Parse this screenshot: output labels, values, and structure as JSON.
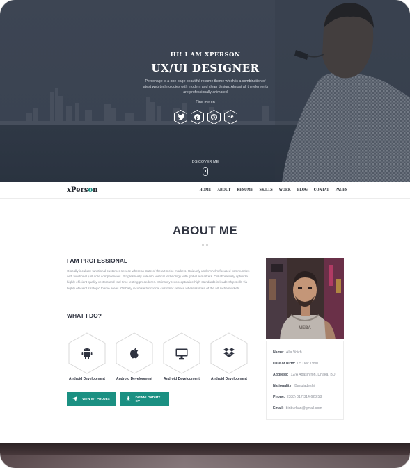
{
  "hero": {
    "greeting": "HI! I AM XPERSON",
    "title": "UX/UI DESIGNER",
    "description": "Personage is a one-page beautiful resume theme which is a combination of latest web technologies with modern and clean design. Almost all the elements are professionally animated",
    "find_me": "Find me on",
    "socials": [
      "twitter-icon",
      "pinterest-icon",
      "dribbble-icon",
      "behance-icon"
    ],
    "discover": "DSICOVER ME"
  },
  "nav": {
    "logo_main": "xPers",
    "logo_accent": "o",
    "logo_end": "n",
    "items": [
      "HOME",
      "ABOUT",
      "RESUME",
      "SKILLS",
      "WORK",
      "BLOG",
      "CONTAT",
      "PAGES"
    ]
  },
  "about": {
    "title": "ABOUT ME",
    "professional_heading": "I AM PROFESSIONAL",
    "professional_text": "Globally incubate functional customer service whereas state of the art niche markets. Uniquely underwhelm focused communities with functional just core competencies. Progressively unleash vertical technology with global e-markets. Collaboratively optimize highly efficient quality vectors and real-time testing procedures. Intrinsicly reconceptualize high standards in leadership skills via highly efficient strategic theme areas. Globally incubate functional customer service whereas state of the art niche markets.",
    "what_heading": "WHAT I DO?",
    "services": [
      {
        "icon": "android-icon",
        "label": "Android Development"
      },
      {
        "icon": "apple-icon",
        "label": "Android Development"
      },
      {
        "icon": "monitor-icon",
        "label": "Android Development"
      },
      {
        "icon": "dropbox-icon",
        "label": "Android Development"
      }
    ],
    "buttons": {
      "projects": "VIEW MY PROJES",
      "download": "DOWNLOAD MY CV"
    },
    "info": {
      "name_label": "Name:",
      "name": "Alla Voich",
      "dob_label": "Date of birth:",
      "dob": "05 Dec 1990",
      "address_label": "Address:",
      "address": "12/A Abasih fon, Dhaka, BD",
      "nationality_label": "Nationality:",
      "nationality": "Bangladeshi",
      "phone_label": "Phone:",
      "phone": "(388) 017 314 628 58",
      "email_label": "Email:",
      "email": "binburhan@gmail.com"
    }
  },
  "colors": {
    "accent": "#1b9082",
    "heading": "#2f3340",
    "hero_bg": "#353c48"
  }
}
